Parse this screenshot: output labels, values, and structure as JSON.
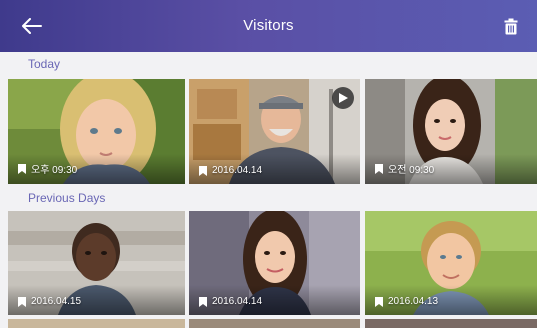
{
  "header": {
    "title": "Visitors",
    "back_icon": "back-arrow-icon",
    "delete_icon": "trash-icon",
    "gradient_start": "#3f3a8c",
    "gradient_end": "#5b5db3"
  },
  "sections": {
    "today": {
      "label": "Today",
      "items": [
        {
          "caption": "오후 09:30",
          "media": "photo"
        },
        {
          "caption": "2016.04.14",
          "media": "video"
        },
        {
          "caption": "오전 09:30",
          "media": "photo"
        }
      ]
    },
    "previous": {
      "label": "Previous Days",
      "items": [
        {
          "caption": "2016.04.15",
          "media": "photo"
        },
        {
          "caption": "2016.04.14",
          "media": "photo"
        },
        {
          "caption": "2016.04.13",
          "media": "photo"
        }
      ]
    }
  },
  "colors": {
    "accent": "#6a67b5",
    "background": "#f2f2f4"
  }
}
